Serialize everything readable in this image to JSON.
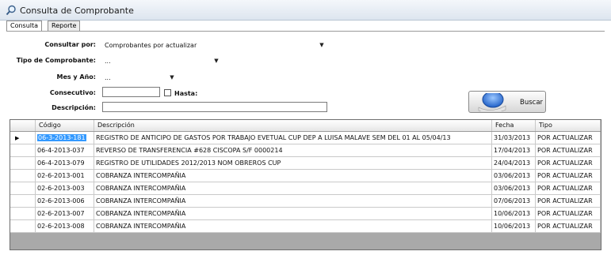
{
  "window": {
    "title": "Consulta de Comprobante"
  },
  "tabs": [
    {
      "label": "Consulta"
    },
    {
      "label": "Reporte"
    }
  ],
  "form": {
    "consultar_por": {
      "label": "Consultar por:",
      "value": "Comprobantes por actualizar"
    },
    "tipo_comprobante": {
      "label": "Tipo de Comprobante:",
      "value": "..."
    },
    "mes_anio": {
      "label": "Mes y Año:",
      "value": "..."
    },
    "consecutivo": {
      "label": "Consecutivo:",
      "value": ""
    },
    "hasta": {
      "label": "Hasta:"
    },
    "descripcion": {
      "label": "Descripción:",
      "value": ""
    }
  },
  "search_button": {
    "label": "Buscar"
  },
  "grid": {
    "columns": [
      "Código",
      "Descripción",
      "Fecha",
      "Tipo"
    ],
    "rows": [
      {
        "codigo": "06-3-2013-181",
        "descripcion": "REGISTRO DE ANTICIPO DE GASTOS POR TRABAJO EVETUAL CUP DEP A LUISA MALAVE SEM DEL 01 AL 05/04/13",
        "fecha": "31/03/2013",
        "tipo": "POR ACTUALIZAR"
      },
      {
        "codigo": "06-4-2013-037",
        "descripcion": "REVERSO DE TRANSFERENCIA #628 CISCOPA S/F 0000214",
        "fecha": "17/04/2013",
        "tipo": "POR ACTUALIZAR"
      },
      {
        "codigo": "06-4-2013-079",
        "descripcion": "REGISTRO DE UTILIDADES 2012/2013 NOM OBREROS CUP",
        "fecha": "24/04/2013",
        "tipo": "POR ACTUALIZAR"
      },
      {
        "codigo": "02-6-2013-001",
        "descripcion": "COBRANZA INTERCOMPAÑIA",
        "fecha": "03/06/2013",
        "tipo": "POR ACTUALIZAR"
      },
      {
        "codigo": "02-6-2013-003",
        "descripcion": "COBRANZA INTERCOMPAÑIA",
        "fecha": "03/06/2013",
        "tipo": "POR ACTUALIZAR"
      },
      {
        "codigo": "02-6-2013-006",
        "descripcion": "COBRANZA INTERCOMPAÑIA",
        "fecha": "07/06/2013",
        "tipo": "POR ACTUALIZAR"
      },
      {
        "codigo": "02-6-2013-007",
        "descripcion": "COBRANZA INTERCOMPAÑIA",
        "fecha": "10/06/2013",
        "tipo": "POR ACTUALIZAR"
      },
      {
        "codigo": "02-6-2013-008",
        "descripcion": "COBRANZA INTERCOMPAÑIA",
        "fecha": "10/06/2013",
        "tipo": "POR ACTUALIZAR"
      }
    ]
  }
}
